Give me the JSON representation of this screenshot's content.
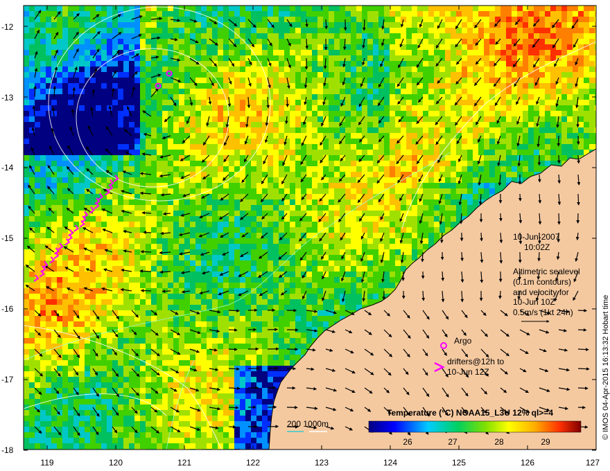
{
  "map": {
    "date_label": "10-Jun-2007",
    "time_label": "10:02Z",
    "altimetry_lines": [
      "Altimetric sealevel",
      "(0.1m contours)",
      "and velocity for",
      "10-Jun 10Z",
      "0.5m/s (1kt 24h)"
    ],
    "argo_label": "Argo",
    "drifter_lines": [
      "drifters@12h to",
      "10-Jun 12Z"
    ],
    "bathy_label": "200  1000m",
    "colorbar_title": "Temperature (°C) NOAA15_L3U 12% ql>=4",
    "colorbar_ticks": [
      "26",
      "27",
      "28",
      "29"
    ],
    "credit": "© IMOS 04-Apr-2015 16:13:32 Hobart time",
    "x_ticks": [
      "119",
      "120",
      "121",
      "122",
      "123",
      "124",
      "125",
      "126",
      "127"
    ],
    "y_ticks": [
      "-12",
      "-13",
      "-14",
      "-15",
      "-16",
      "-17",
      "-18"
    ],
    "colors": {
      "land": "#f5c9a0",
      "coast": "#000000",
      "drifter": "#ff00ff",
      "argo": "#ff00ff",
      "bathy_200": "#99ffff",
      "bathy_1000": "#ffffff"
    }
  }
}
